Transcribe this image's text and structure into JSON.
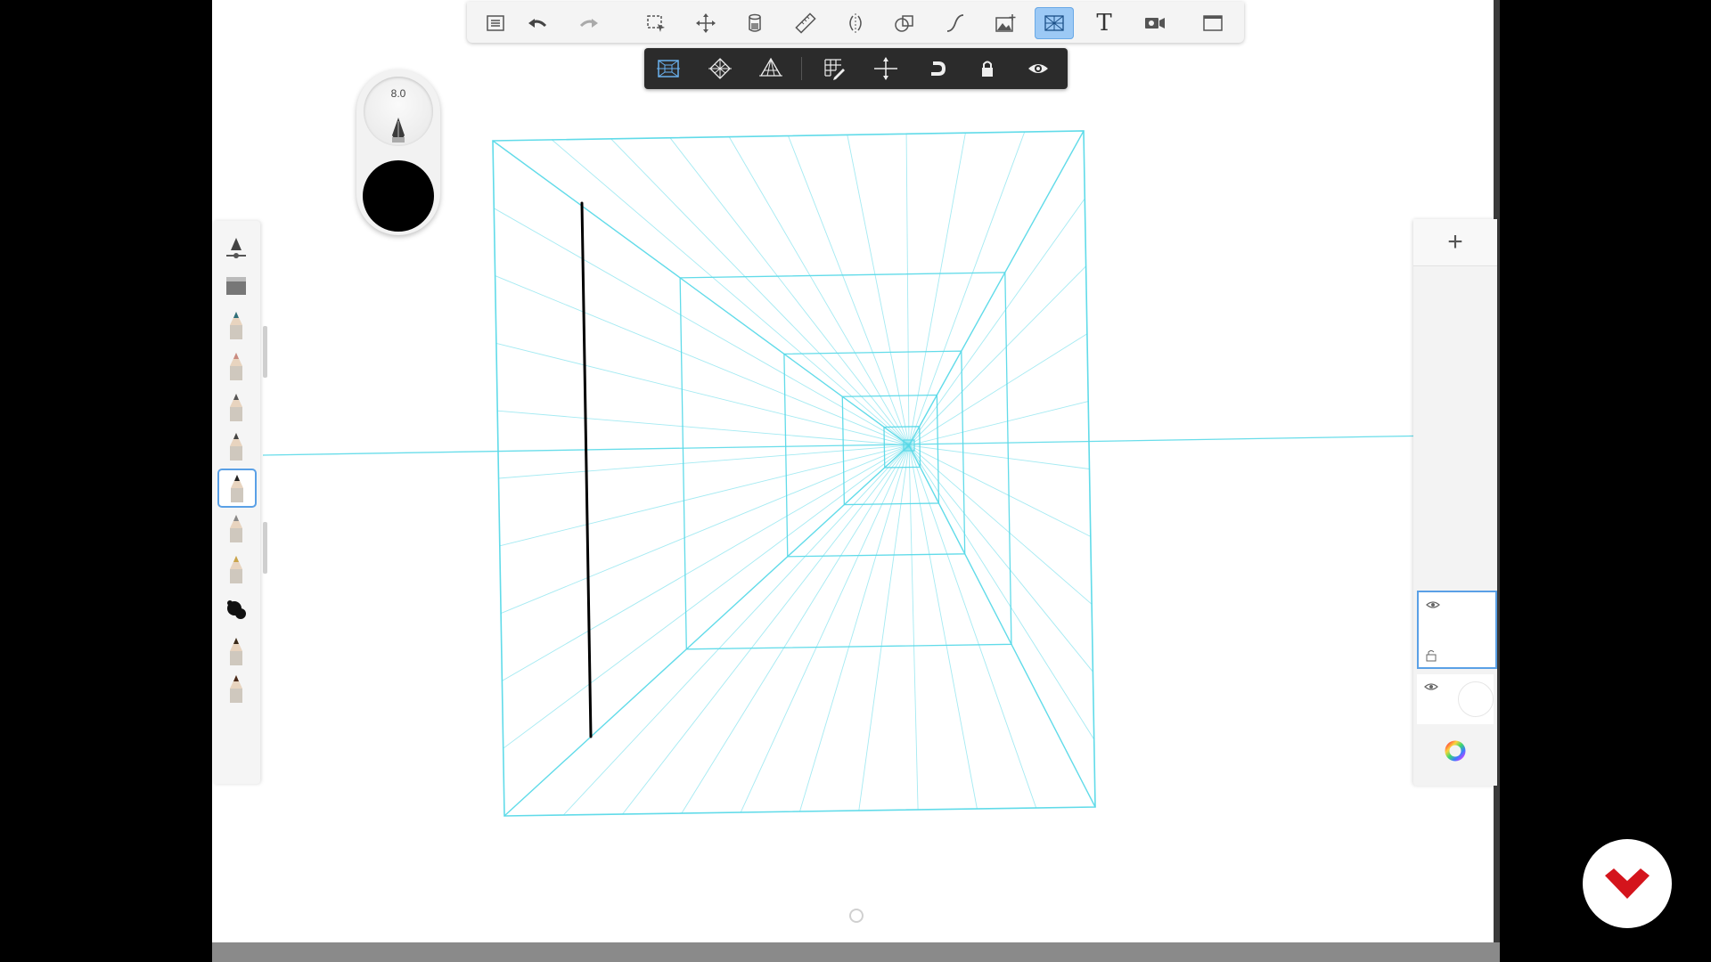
{
  "app": {
    "brush_size": "8.0",
    "current_color": "#000000",
    "guide_color": "#59d9e8",
    "accent_color": "#9cc9f5"
  },
  "toolbar": {
    "items": [
      {
        "name": "brush-library-icon",
        "label": ""
      },
      {
        "name": "undo-icon",
        "label": ""
      },
      {
        "name": "redo-icon",
        "label": ""
      },
      {
        "name": "selection-icon",
        "label": ""
      },
      {
        "name": "transform-icon",
        "label": ""
      },
      {
        "name": "fill-icon",
        "label": ""
      },
      {
        "name": "ruler-icon",
        "label": ""
      },
      {
        "name": "symmetry-icon",
        "label": ""
      },
      {
        "name": "shape-guide-icon",
        "label": ""
      },
      {
        "name": "stroke-icon",
        "label": ""
      },
      {
        "name": "import-image-icon",
        "label": ""
      },
      {
        "name": "perspective-guide-icon",
        "label": "",
        "active": true
      },
      {
        "name": "text-icon",
        "label": "T"
      },
      {
        "name": "time-lapse-icon",
        "label": ""
      },
      {
        "name": "fullscreen-icon",
        "label": ""
      }
    ]
  },
  "perspective_toolbar": {
    "items": [
      {
        "name": "one-point-perspective-icon",
        "active": true
      },
      {
        "name": "two-point-perspective-icon"
      },
      {
        "name": "three-point-perspective-icon"
      },
      {
        "name": "edit-grid-icon"
      },
      {
        "name": "horizon-icon"
      },
      {
        "name": "snap-icon"
      },
      {
        "name": "lock-icon"
      },
      {
        "name": "visibility-icon"
      }
    ]
  },
  "brush_palette": {
    "items": [
      {
        "name": "brush-properties-icon"
      },
      {
        "name": "eraser-icon"
      },
      {
        "name": "pencil-icon"
      },
      {
        "name": "pencil-pink-icon"
      },
      {
        "name": "marker-icon"
      },
      {
        "name": "felt-tip-icon"
      },
      {
        "name": "ballpoint-pen-icon",
        "selected": true
      },
      {
        "name": "airbrush-icon"
      },
      {
        "name": "paintbrush-icon"
      },
      {
        "name": "smudge-icon"
      },
      {
        "name": "paint-tip-icon"
      },
      {
        "name": "calligraphy-tip-icon"
      }
    ]
  },
  "layers": {
    "add_label": "+",
    "items": [
      {
        "name": "layer-1",
        "selected": true
      },
      {
        "name": "background-layer",
        "selected": false
      }
    ]
  }
}
